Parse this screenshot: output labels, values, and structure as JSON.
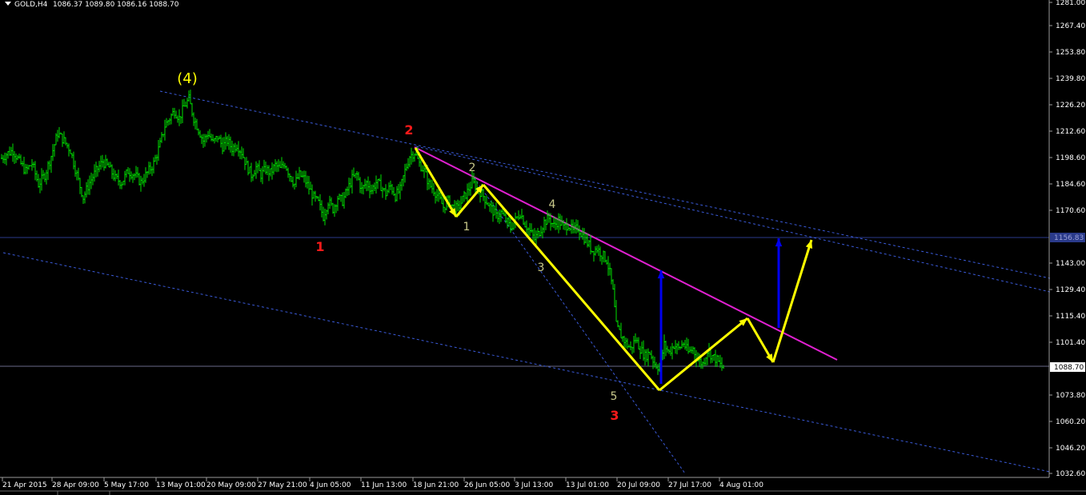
{
  "header": {
    "symbol": "GOLD,H4",
    "ohlc": "1086.37 1089.80 1086.16 1088.70"
  },
  "colors": {
    "background": "#000000",
    "bars": "#00e000",
    "grid_line": "#2a3a8a",
    "channel": "#3a5ad8",
    "trendline": "#e020d0",
    "projection": "#ffff00",
    "target_arrow": "#0000ee",
    "label_red": "#ff1a1a",
    "label_yellow": "#ffff00",
    "label_small": "#c8c88a"
  },
  "chart_data": {
    "type": "candlestick",
    "symbol": "GOLD",
    "timeframe": "H4",
    "last_price": "1088.70",
    "highlight_level": "1156.83",
    "y_ticks": [
      "1281.00",
      "1267.40",
      "1253.80",
      "1239.80",
      "1226.20",
      "1212.60",
      "1198.60",
      "1184.60",
      "1170.60",
      "1156.83",
      "1143.00",
      "1129.40",
      "1115.40",
      "1101.40",
      "1088.70",
      "1073.80",
      "1060.20",
      "1046.20",
      "1032.60"
    ],
    "x_ticks": [
      "21 Apr 2015",
      "28 Apr 09:00",
      "5 May 17:00",
      "13 May 01:00",
      "20 May 09:00",
      "27 May 21:00",
      "4 Jun 05:00",
      "11 Jun 13:00",
      "18 Jun 21:00",
      "26 Jun 05:00",
      "3 Jul 13:00",
      "13 Jul 01:00",
      "20 Jul 09:00",
      "27 Jul 17:00",
      "4 Aug 01:00"
    ],
    "price_path": [
      [
        0,
        1198
      ],
      [
        8,
        1201
      ],
      [
        16,
        1203
      ],
      [
        24,
        1197
      ],
      [
        32,
        1192
      ],
      [
        40,
        1196
      ],
      [
        48,
        1185
      ],
      [
        56,
        1190
      ],
      [
        64,
        1200
      ],
      [
        72,
        1212
      ],
      [
        80,
        1208
      ],
      [
        88,
        1203
      ],
      [
        96,
        1190
      ],
      [
        104,
        1178
      ],
      [
        112,
        1186
      ],
      [
        120,
        1192
      ],
      [
        128,
        1197
      ],
      [
        136,
        1194
      ],
      [
        144,
        1188
      ],
      [
        152,
        1186
      ],
      [
        160,
        1192
      ],
      [
        168,
        1190
      ],
      [
        176,
        1186
      ],
      [
        184,
        1191
      ],
      [
        192,
        1196
      ],
      [
        200,
        1206
      ],
      [
        206,
        1216
      ],
      [
        212,
        1220
      ],
      [
        218,
        1224
      ],
      [
        224,
        1220
      ],
      [
        230,
        1226
      ],
      [
        236,
        1230
      ],
      [
        242,
        1220
      ],
      [
        248,
        1214
      ],
      [
        254,
        1208
      ],
      [
        260,
        1212
      ],
      [
        266,
        1207
      ],
      [
        272,
        1210
      ],
      [
        278,
        1205
      ],
      [
        284,
        1208
      ],
      [
        290,
        1204
      ],
      [
        296,
        1206
      ],
      [
        302,
        1202
      ],
      [
        308,
        1195
      ],
      [
        314,
        1190
      ],
      [
        320,
        1194
      ],
      [
        326,
        1190
      ],
      [
        332,
        1193
      ],
      [
        338,
        1191
      ],
      [
        344,
        1195
      ],
      [
        350,
        1193
      ],
      [
        356,
        1196
      ],
      [
        362,
        1190
      ],
      [
        368,
        1185
      ],
      [
        374,
        1190
      ],
      [
        380,
        1188
      ],
      [
        386,
        1183
      ],
      [
        392,
        1178
      ],
      [
        398,
        1175
      ],
      [
        404,
        1168
      ],
      [
        410,
        1176
      ],
      [
        416,
        1172
      ],
      [
        422,
        1178
      ],
      [
        428,
        1176
      ],
      [
        434,
        1182
      ],
      [
        440,
        1188
      ],
      [
        446,
        1190
      ],
      [
        452,
        1182
      ],
      [
        458,
        1186
      ],
      [
        464,
        1182
      ],
      [
        470,
        1186
      ],
      [
        476,
        1184
      ],
      [
        482,
        1180
      ],
      [
        488,
        1184
      ],
      [
        494,
        1179
      ],
      [
        500,
        1182
      ],
      [
        506,
        1192
      ],
      [
        512,
        1200
      ],
      [
        518,
        1202
      ],
      [
        524,
        1196
      ],
      [
        530,
        1192
      ],
      [
        536,
        1185
      ],
      [
        542,
        1182
      ],
      [
        548,
        1178
      ],
      [
        554,
        1173
      ],
      [
        560,
        1176
      ],
      [
        566,
        1173
      ],
      [
        572,
        1172
      ],
      [
        578,
        1177
      ],
      [
        584,
        1181
      ],
      [
        590,
        1186
      ],
      [
        596,
        1183
      ],
      [
        602,
        1180
      ],
      [
        608,
        1176
      ],
      [
        614,
        1172
      ],
      [
        620,
        1168
      ],
      [
        626,
        1170
      ],
      [
        632,
        1166
      ],
      [
        638,
        1162
      ],
      [
        644,
        1166
      ],
      [
        650,
        1170
      ],
      [
        656,
        1164
      ],
      [
        662,
        1160
      ],
      [
        668,
        1156
      ],
      [
        674,
        1160
      ],
      [
        680,
        1165
      ],
      [
        686,
        1167
      ],
      [
        692,
        1163
      ],
      [
        698,
        1166
      ],
      [
        704,
        1162
      ],
      [
        710,
        1164
      ],
      [
        716,
        1160
      ],
      [
        722,
        1162
      ],
      [
        728,
        1158
      ],
      [
        734,
        1154
      ],
      [
        740,
        1150
      ],
      [
        746,
        1151
      ],
      [
        752,
        1148
      ],
      [
        758,
        1145
      ],
      [
        762,
        1138
      ],
      [
        766,
        1128
      ],
      [
        770,
        1110
      ],
      [
        776,
        1105
      ],
      [
        782,
        1101
      ],
      [
        788,
        1098
      ],
      [
        794,
        1103
      ],
      [
        800,
        1098
      ],
      [
        806,
        1094
      ],
      [
        812,
        1096
      ],
      [
        818,
        1090
      ],
      [
        824,
        1088
      ],
      [
        830,
        1100
      ],
      [
        836,
        1096
      ],
      [
        842,
        1100
      ],
      [
        848,
        1098
      ],
      [
        854,
        1101
      ],
      [
        860,
        1096
      ],
      [
        866,
        1098
      ],
      [
        872,
        1092
      ],
      [
        878,
        1090
      ],
      [
        884,
        1097
      ],
      [
        890,
        1094
      ],
      [
        896,
        1092
      ],
      [
        902,
        1088
      ]
    ],
    "wave_labels": [
      {
        "text": "(4)",
        "style": "yellow"
      },
      {
        "text": "1",
        "style": "red"
      },
      {
        "text": "2",
        "style": "red"
      },
      {
        "text": "3",
        "style": "red"
      },
      {
        "text": "1",
        "style": "small"
      },
      {
        "text": "2",
        "style": "small"
      },
      {
        "text": "3",
        "style": "small"
      },
      {
        "text": "4",
        "style": "small"
      },
      {
        "text": "5",
        "style": "small"
      }
    ]
  }
}
